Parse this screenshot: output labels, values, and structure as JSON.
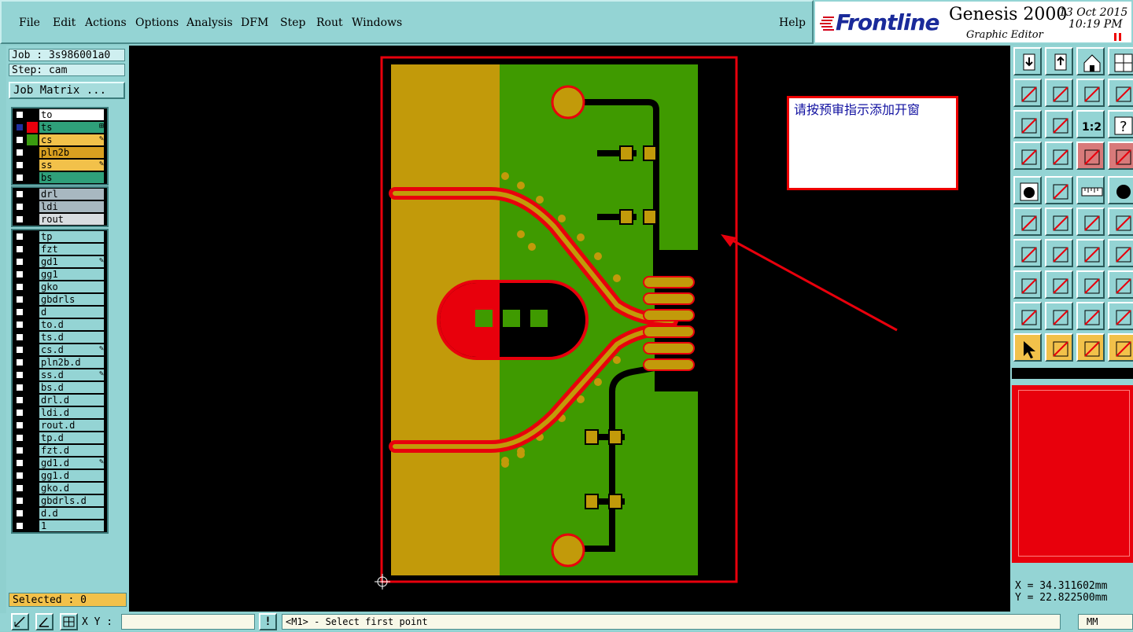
{
  "menu": {
    "items": [
      "File",
      "Edit",
      "Actions",
      "Options",
      "Analysis",
      "DFM",
      "Step",
      "Rout",
      "Windows"
    ],
    "help": "Help"
  },
  "brand": {
    "logo": "Frontline",
    "product": "Genesis 2000",
    "editor": "Graphic Editor",
    "date": "13 Oct 2015",
    "time": "10:19 PM"
  },
  "job": {
    "job_label": "Job : 3s986001a0",
    "step_label": "Step: cam",
    "matrix_button": "Job Matrix ...",
    "selected": "Selected : 0"
  },
  "layers": {
    "board": [
      {
        "name": "to",
        "swatch": "#000000",
        "bg": "#ffffff",
        "mark": ""
      },
      {
        "name": "ts",
        "swatch": "#e8000c",
        "bg": "#2fa07a",
        "mark": "⊞",
        "active": true
      },
      {
        "name": "cs",
        "swatch": "#3a9a10",
        "bg": "#f2c14a",
        "mark": "✎"
      },
      {
        "name": "pln2b",
        "swatch": "#000000",
        "bg": "#d9a020",
        "mark": ""
      },
      {
        "name": "ss",
        "swatch": "#000000",
        "bg": "#f2c14a",
        "mark": "✎"
      },
      {
        "name": "bs",
        "swatch": "#000000",
        "bg": "#2fa07a",
        "mark": ""
      }
    ],
    "drill": [
      {
        "name": "drl",
        "swatch": "#000000",
        "bg": "#a8b8c0",
        "mark": ""
      },
      {
        "name": "ldi",
        "swatch": "#000000",
        "bg": "#a8b8c0",
        "mark": ""
      },
      {
        "name": "rout",
        "swatch": "#000000",
        "bg": "#d8dde0",
        "mark": ""
      }
    ],
    "misc": [
      {
        "name": "tp",
        "mark": ""
      },
      {
        "name": "fzt",
        "mark": ""
      },
      {
        "name": "gd1",
        "mark": "✎"
      },
      {
        "name": "gg1",
        "mark": ""
      },
      {
        "name": "gko",
        "mark": ""
      },
      {
        "name": "gbdrls",
        "mark": ""
      },
      {
        "name": "d",
        "mark": ""
      },
      {
        "name": "to.d",
        "mark": ""
      },
      {
        "name": "ts.d",
        "mark": ""
      },
      {
        "name": "cs.d",
        "mark": "✎"
      },
      {
        "name": "pln2b.d",
        "mark": ""
      },
      {
        "name": "ss.d",
        "mark": "✎"
      },
      {
        "name": "bs.d",
        "mark": ""
      },
      {
        "name": "drl.d",
        "mark": ""
      },
      {
        "name": "ldi.d",
        "mark": ""
      },
      {
        "name": "rout.d",
        "mark": ""
      },
      {
        "name": "tp.d",
        "mark": ""
      },
      {
        "name": "fzt.d",
        "mark": ""
      },
      {
        "name": "gd1.d",
        "mark": "✎"
      },
      {
        "name": "gg1.d",
        "mark": ""
      },
      {
        "name": "gko.d",
        "mark": ""
      },
      {
        "name": "gbdrls.d",
        "mark": ""
      },
      {
        "name": "d.d",
        "mark": ""
      },
      {
        "name": "1",
        "mark": ""
      }
    ]
  },
  "canvas": {
    "note": "请按预审指示添加开窗"
  },
  "tools": {
    "icons": [
      "import-icon",
      "export-icon",
      "home-icon",
      "window-icon",
      "panel-left-icon",
      "panel-right-icon",
      "swap-icon",
      "s-curve-icon",
      "zoom-fit-icon",
      "zoom-center-icon",
      "scale-1-2-icon",
      "help-icon",
      "tool-a-icon",
      "probe-icon",
      "net-icon",
      "net-alt-icon",
      "pad-icon",
      "polygon-icon",
      "ruler-icon",
      "circle-icon",
      "connect-icon",
      "cross-icon",
      "line-end-icon",
      "arrow-line-icon",
      "angle-icon",
      "slash-icon",
      "rotate-icon",
      "mirror-icon",
      "snap-icon",
      "minus-icon",
      "align-icon",
      "group-icon",
      "triangle-icon",
      "arrow-triangle-icon",
      "arc-icon",
      "arc-alt-icon",
      "select-icon",
      "select-box-icon",
      "select-touch-icon",
      "select-net-icon"
    ],
    "label_1_2": "1:2",
    "help_label": "?"
  },
  "coords": {
    "x": "X = 34.311602mm",
    "y": "Y = 22.822500mm"
  },
  "status": {
    "xy_label": "X Y :",
    "alert": "!",
    "prompt": "<M1> - Select first point",
    "units": "MM"
  }
}
